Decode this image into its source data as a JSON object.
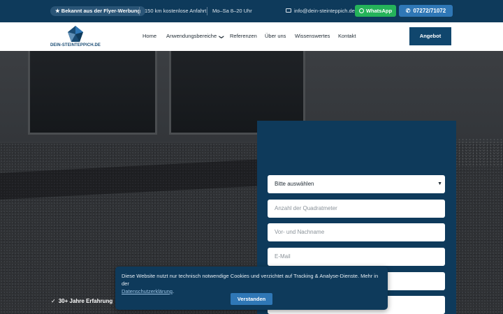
{
  "topbar": {
    "badge": "★ Bekannt aus der Flyer-Werbung",
    "travel": "150 km kostenlose Anfahrt",
    "hours": "Mo–Sa 8–20 Uhr",
    "email": "info@dein-steinteppich.de",
    "whatsapp": "WhatsApp",
    "phone": "07272/71072"
  },
  "nav": {
    "logo_text": "DEIN-STEINTEPPICH.DE",
    "items": [
      "Home",
      "Anwendungsbereiche",
      "Referenzen",
      "Über uns",
      "Wissenswertes",
      "Kontakt"
    ],
    "chevron": "❯",
    "offer_button": "Angebot"
  },
  "hero": {
    "trust_check": "✓",
    "trust_item": "30+ Jahre Erfahrung"
  },
  "form": {
    "select_value": "Bitte auswählen",
    "select_caret": "▼",
    "placeholders": [
      "Anzahl der Quadratmeter",
      "Vor- und Nachname",
      "E-Mail"
    ]
  },
  "cookie": {
    "text": "Diese Website nutzt nur technisch notwendige Cookies und verzichtet auf Tracking & Analyse-Dienste. Mehr in der",
    "link": "Datenschutzerklärung",
    "period": ".",
    "button": "Verstanden"
  },
  "colors": {
    "primary": "#0e3a5b",
    "accent": "#2f77b6",
    "whatsapp": "#25b35a"
  },
  "icons": {
    "mail": "mail-icon",
    "whatsapp": "whatsapp-icon",
    "phone": "phone-icon"
  }
}
